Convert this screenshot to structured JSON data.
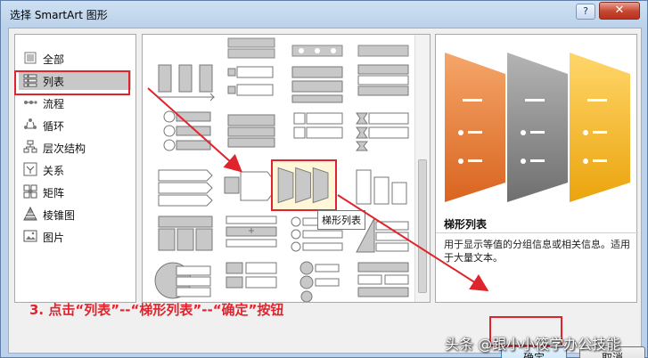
{
  "window": {
    "title": "选择 SmartArt 图形",
    "help": "?",
    "close": "✕"
  },
  "categories": [
    {
      "label": "全部",
      "icon": "all-icon"
    },
    {
      "label": "列表",
      "icon": "list-icon",
      "selected": true
    },
    {
      "label": "流程",
      "icon": "process-icon"
    },
    {
      "label": "循环",
      "icon": "cycle-icon"
    },
    {
      "label": "层次结构",
      "icon": "hierarchy-icon"
    },
    {
      "label": "关系",
      "icon": "relationship-icon"
    },
    {
      "label": "矩阵",
      "icon": "matrix-icon"
    },
    {
      "label": "棱锥图",
      "icon": "pyramid-icon"
    },
    {
      "label": "图片",
      "icon": "picture-icon"
    }
  ],
  "gallery": {
    "selected_tooltip": "梯形列表"
  },
  "preview": {
    "name": "梯形列表",
    "description": "用于显示等值的分组信息或相关信息。适用于大量文本。",
    "colors": {
      "orange": "#e8772e",
      "gray": "#8c8c8c",
      "gold": "#f2b21b"
    }
  },
  "annotation": "3. 点击“列表”--“梯形列表”--“确定”按钮",
  "buttons": {
    "ok": "确定",
    "cancel": "取消"
  },
  "watermark": "头条 @跟小小筱学办公技能",
  "colors": {
    "highlight": "#e0242d"
  }
}
